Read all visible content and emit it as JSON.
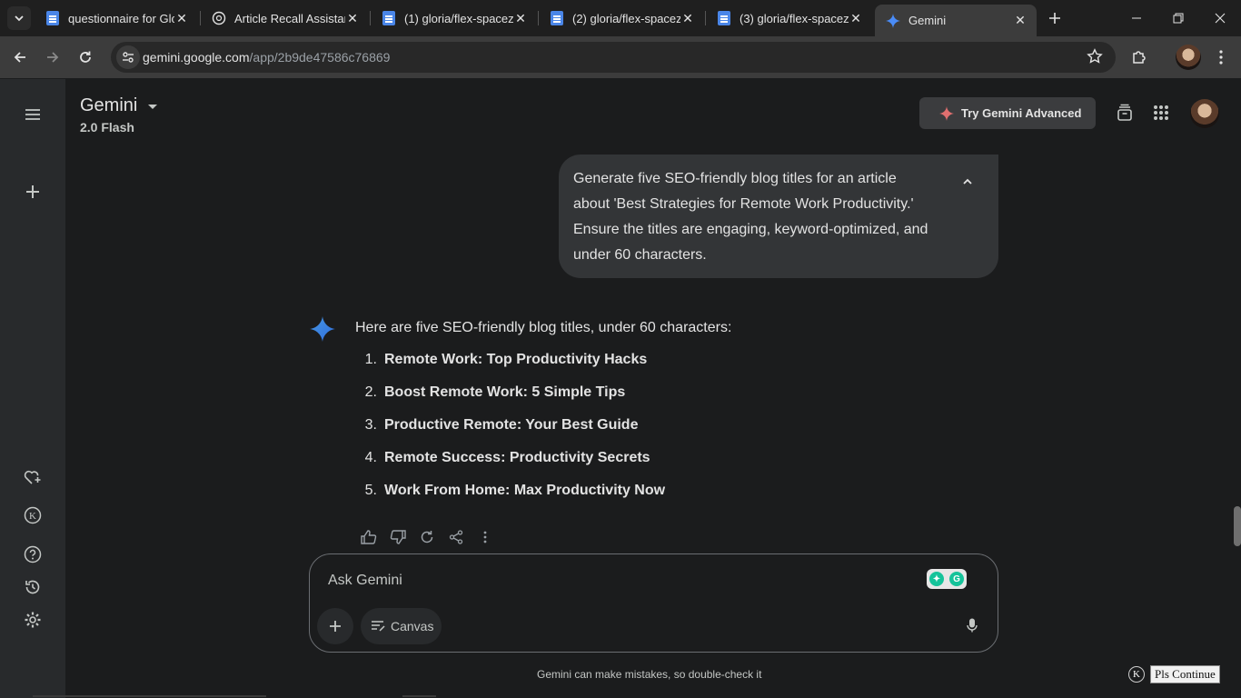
{
  "browser": {
    "tabs": [
      {
        "title": "questionnaire for Glo",
        "favicon": "google-docs-icon"
      },
      {
        "title": "Article Recall Assistan",
        "favicon": "chatgpt-icon"
      },
      {
        "title": "(1) gloria/flex-spacez",
        "favicon": "google-docs-icon"
      },
      {
        "title": "(2) gloria/flex-spacez",
        "favicon": "google-docs-icon"
      },
      {
        "title": "(3) gloria/flex-spacez",
        "favicon": "google-docs-icon"
      },
      {
        "title": "Gemini",
        "favicon": "gemini-icon",
        "active": true
      }
    ],
    "url_host": "gemini.google.com",
    "url_path": "/app/2b9de47586c76869"
  },
  "header": {
    "brand": "Gemini",
    "model": "2.0 Flash",
    "try_advanced": "Try Gemini Advanced"
  },
  "conversation": {
    "user_prompt": "Generate five SEO-friendly blog titles for an article about 'Best Strategies for Remote Work Productivity.' Ensure the titles are engaging, keyword-optimized, and under 60 characters.",
    "response_intro": "Here are five SEO-friendly blog titles, under 60 characters:",
    "response_items": [
      {
        "num": "1.",
        "text": "Remote Work: Top Productivity Hacks"
      },
      {
        "num": "2.",
        "text": "Boost Remote Work: 5 Simple Tips"
      },
      {
        "num": "3.",
        "text": "Productive Remote: Your Best Guide"
      },
      {
        "num": "4.",
        "text": "Remote Success: Productivity Secrets"
      },
      {
        "num": "5.",
        "text": "Work From Home: Max Productivity Now"
      }
    ]
  },
  "composer": {
    "placeholder": "Ask Gemini",
    "canvas_label": "Canvas"
  },
  "footer": {
    "disclaimer": "Gemini can make mistakes, so double-check it",
    "pls_continue": "Pls Continue",
    "k_badge": "K"
  },
  "colors": {
    "background": "#1b1c1d",
    "sidebar": "#282a2c",
    "user_bubble": "#333537",
    "gemini_blue": "#4285f4"
  }
}
